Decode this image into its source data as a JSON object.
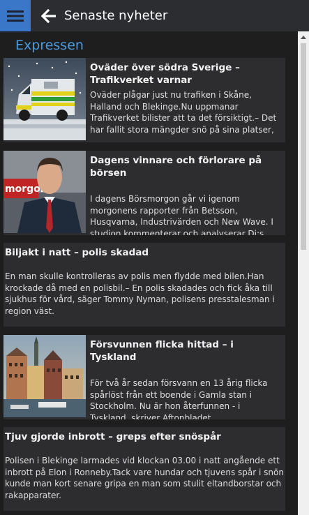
{
  "header": {
    "title": "Senaste nyheter",
    "menu_icon": "hamburger-menu-icon",
    "back_icon": "back-arrow-icon",
    "accent_color": "#3a77c8"
  },
  "section": {
    "title": "Expressen",
    "color": "#4b9be0"
  },
  "articles": [
    {
      "title": "Oväder över södra Sverige – Trafikverket varnar",
      "summary": "Oväder plågar just nu trafiken i Skåne, Halland och Blekinge.Nu uppmanar Trafikverket bilister att ta det försiktigt.– Det har fallit stora mängder snö på sina platser, se till att dämpa hastigheten",
      "image": "ambulance-in-snow"
    },
    {
      "title": "Dagens vinnare och förlorare på börsen",
      "summary": "I dagens Börsmorgon går vi igenom morgonens rapporter från Betsson, Husqvarna, Industrivärden och New Wave. I studion kommenterar och analyserar Di:s analytiker",
      "image": "news-presenter",
      "image_text": "morgon"
    },
    {
      "title": "Biljakt i natt – polis skadad",
      "summary": "En man skulle kontrolleras av polis men flydde med bilen.Han krockade då med en polisbil.– En polis skadades och fick åka till sjukhus för vård, säger Tommy Nyman, polisens presstalesman i region väst."
    },
    {
      "title": "Försvunnen flicka hittad – i Tyskland",
      "summary": "För två år sedan försvann en 13 årig flicka spårlöst från ett boende i Gamla stan i Stockholm. Nu är hon återfunnen - i Tyskland, skriver Aftonbladet.",
      "image": "gamla-stan-skyline"
    },
    {
      "title": "Tjuv gjorde inbrott – greps efter snöspår",
      "summary": "Polisen i Blekinge larmades vid klockan 03.00 i natt angående ett inbrott på Elon i Ronneby.Tack vare hundar och tjuvens spår i snön kunde man kort senare gripa en man som stulit eltandborstar och rakapparater."
    }
  ]
}
